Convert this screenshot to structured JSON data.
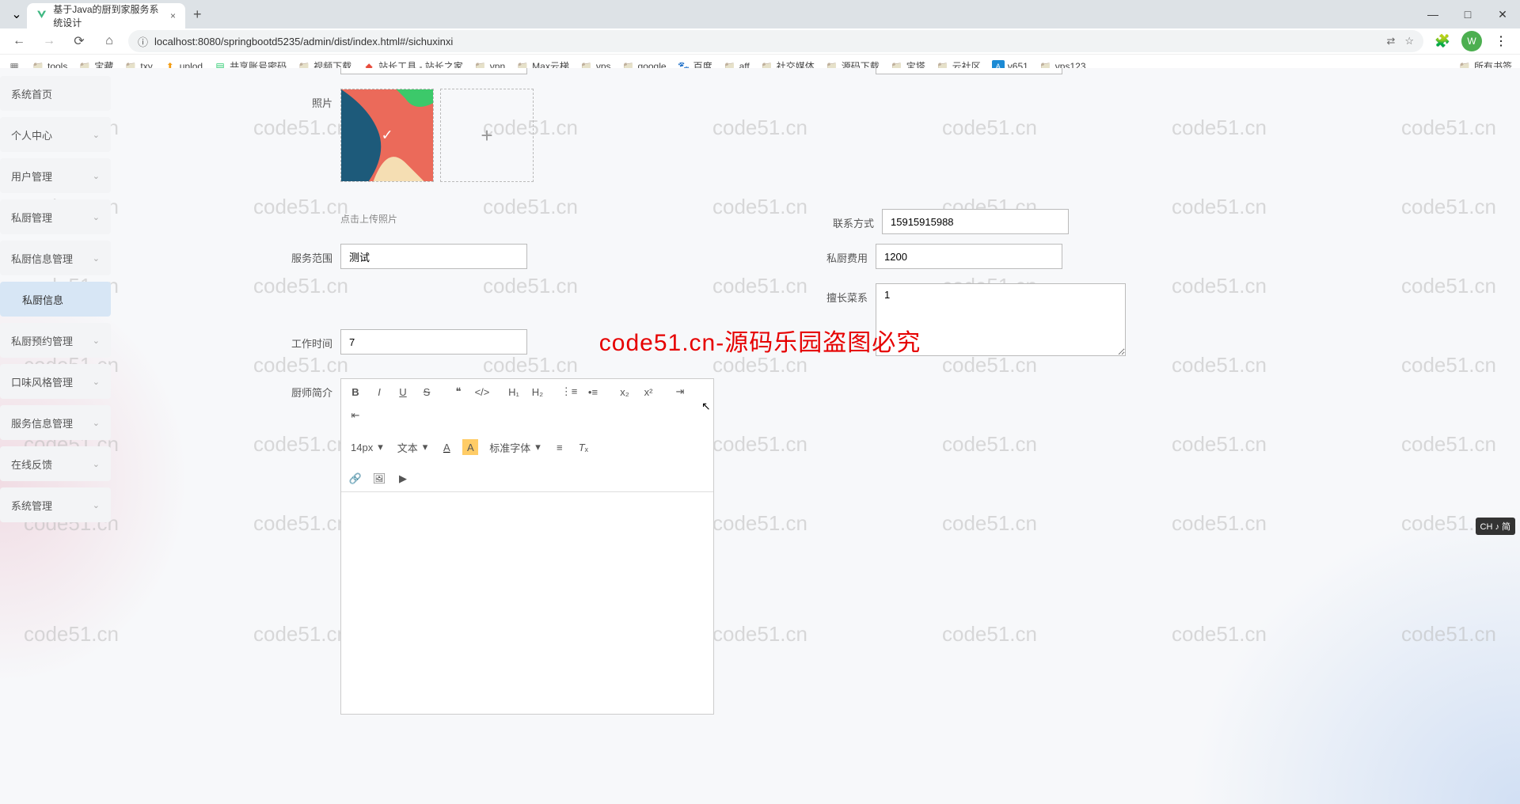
{
  "browser": {
    "tab_title": "基于Java的厨到家服务系统设计",
    "tab_close": "×",
    "new_tab": "+",
    "url": "localhost:8080/springbootd5235/admin/dist/index.html#/sichuxinxi",
    "window": {
      "min": "—",
      "max": "□",
      "close": "✕"
    },
    "avatar_letter": "W"
  },
  "bookmarks": [
    {
      "icon": "apps",
      "label": ""
    },
    {
      "icon": "folder",
      "label": "tools"
    },
    {
      "icon": "folder",
      "label": "宝藏"
    },
    {
      "icon": "folder",
      "label": "txy"
    },
    {
      "icon": "upload",
      "label": "uplod"
    },
    {
      "icon": "note",
      "label": "共享账号密码"
    },
    {
      "icon": "folder",
      "label": "视频下载"
    },
    {
      "icon": "site",
      "label": "站长工具 - 站长之家"
    },
    {
      "icon": "folder",
      "label": "vpn"
    },
    {
      "icon": "folder",
      "label": "Max云梯"
    },
    {
      "icon": "folder",
      "label": "vps"
    },
    {
      "icon": "folder",
      "label": "google"
    },
    {
      "icon": "baidu",
      "label": "百度"
    },
    {
      "icon": "folder",
      "label": "aff"
    },
    {
      "icon": "folder",
      "label": "社交媒体"
    },
    {
      "icon": "folder",
      "label": "源码下载"
    },
    {
      "icon": "folder",
      "label": "宝塔"
    },
    {
      "icon": "folder",
      "label": "云社区"
    },
    {
      "icon": "v651",
      "label": "v651"
    },
    {
      "icon": "folder",
      "label": "vps123"
    }
  ],
  "bookmark_all": "所有书签",
  "sidebar": {
    "items": [
      {
        "label": "系统首页",
        "expandable": false
      },
      {
        "label": "个人中心",
        "expandable": true
      },
      {
        "label": "用户管理",
        "expandable": true
      },
      {
        "label": "私厨管理",
        "expandable": true
      },
      {
        "label": "私厨信息管理",
        "expandable": true,
        "open": true
      },
      {
        "label": "私厨信息",
        "expandable": false,
        "active": true
      },
      {
        "label": "私厨预约管理",
        "expandable": true
      },
      {
        "label": "口味风格管理",
        "expandable": true
      },
      {
        "label": "服务信息管理",
        "expandable": true
      },
      {
        "label": "在线反馈",
        "expandable": true
      },
      {
        "label": "系统管理",
        "expandable": true
      }
    ]
  },
  "form": {
    "photo_label": "照片",
    "upload_hint": "点击上传照片",
    "contact_label": "联系方式",
    "contact_value": "15915915988",
    "scope_label": "服务范围",
    "scope_value": "测试",
    "fee_label": "私厨费用",
    "fee_value": "1200",
    "cuisine_label": "擅长菜系",
    "cuisine_value": "1",
    "worktime_label": "工作时间",
    "worktime_value": "7",
    "intro_label": "厨师简介"
  },
  "editor": {
    "font_size": "14px",
    "text_type": "文本",
    "font_family": "标准字体"
  },
  "watermark_text": "code51.cn",
  "center_banner": "code51.cn-源码乐园盗图必究",
  "ime": "CH ♪ 简"
}
